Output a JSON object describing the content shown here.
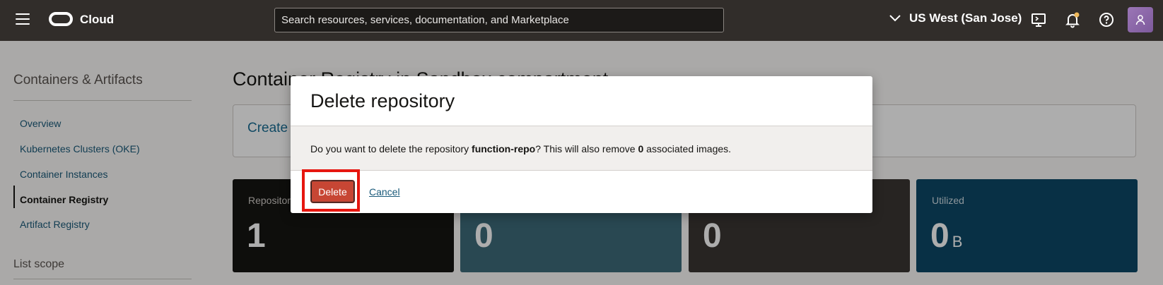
{
  "topbar": {
    "brand": "Cloud",
    "search_placeholder": "Search resources, services, documentation, and Marketplace",
    "region": "US West (San Jose)",
    "icons": [
      "menu-icon",
      "oracle-logo-icon",
      "chevron-down-icon",
      "cloud-shell-icon",
      "bell-icon",
      "help-icon",
      "user-icon"
    ],
    "bell_badge_color": "#f0b95a"
  },
  "sidebar": {
    "title": "Containers & Artifacts",
    "items": [
      {
        "label": "Overview"
      },
      {
        "label": "Kubernetes Clusters (OKE)"
      },
      {
        "label": "Container Instances"
      },
      {
        "label": "Container Registry",
        "active": true
      },
      {
        "label": "Artifact Registry"
      }
    ],
    "scope_title": "List scope"
  },
  "main": {
    "page_title": "Container Registry in Sandbox compartment",
    "create_text": "Create",
    "stats": [
      {
        "label": "Repositories",
        "value": "1",
        "unit": "",
        "bg": "#161513"
      },
      {
        "label": "",
        "value": "0",
        "unit": "",
        "bg": "#3d6b7a"
      },
      {
        "label": "",
        "value": "0",
        "unit": "",
        "bg": "#3a3633"
      },
      {
        "label": "Utilized",
        "value": "0",
        "unit": "B",
        "bg": "#0c4766"
      }
    ]
  },
  "dialog": {
    "title": "Delete repository",
    "message_prefix": "Do you want to delete the repository ",
    "repo_name": "function-repo",
    "message_middle": "? This will also remove ",
    "image_count": "0",
    "message_suffix": " associated images.",
    "delete_label": "Delete",
    "cancel_label": "Cancel",
    "highlight_color": "#e6160f"
  }
}
